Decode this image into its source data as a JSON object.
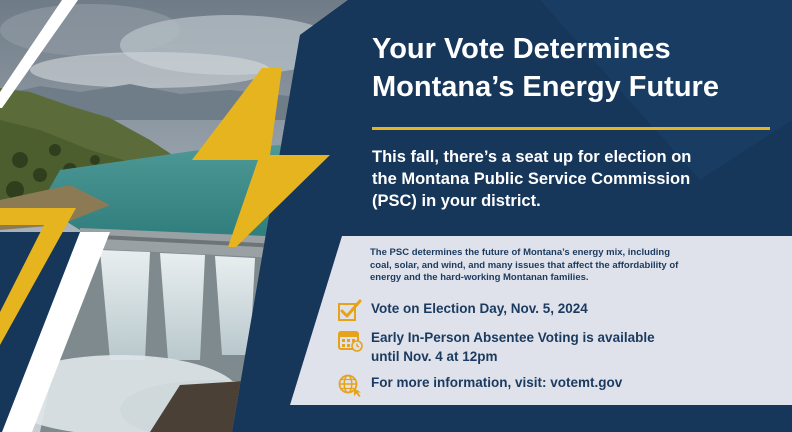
{
  "headline": {
    "line1": "Your Vote Determines",
    "line2": "Montana’s Energy Future"
  },
  "intro": {
    "line1": "This fall, there’s a seat up for election on",
    "line2": "the Montana Public Service Commission",
    "line3": "(PSC) in your district."
  },
  "info": {
    "line1": "The PSC determines the future of Montana’s energy mix, including",
    "line2": "coal, solar, and wind, and many issues that affect the affordability of",
    "line3": "energy and the hard-working Montanan families."
  },
  "items": [
    {
      "icon": "checkbox-icon",
      "line1": "Vote on Election Day, Nov. 5, 2024"
    },
    {
      "icon": "calendar-icon",
      "line1": "Early In-Person Absentee Voting is available",
      "line2": "until Nov. 4 at 12pm"
    },
    {
      "icon": "globe-icon",
      "line1": "For more information, visit: votemt.gov"
    }
  ],
  "colors": {
    "navy": "#16365a",
    "accent_gold": "#e6b41e",
    "info_panel": "#dfe2ea",
    "text_dark": "#1b3a5f"
  }
}
